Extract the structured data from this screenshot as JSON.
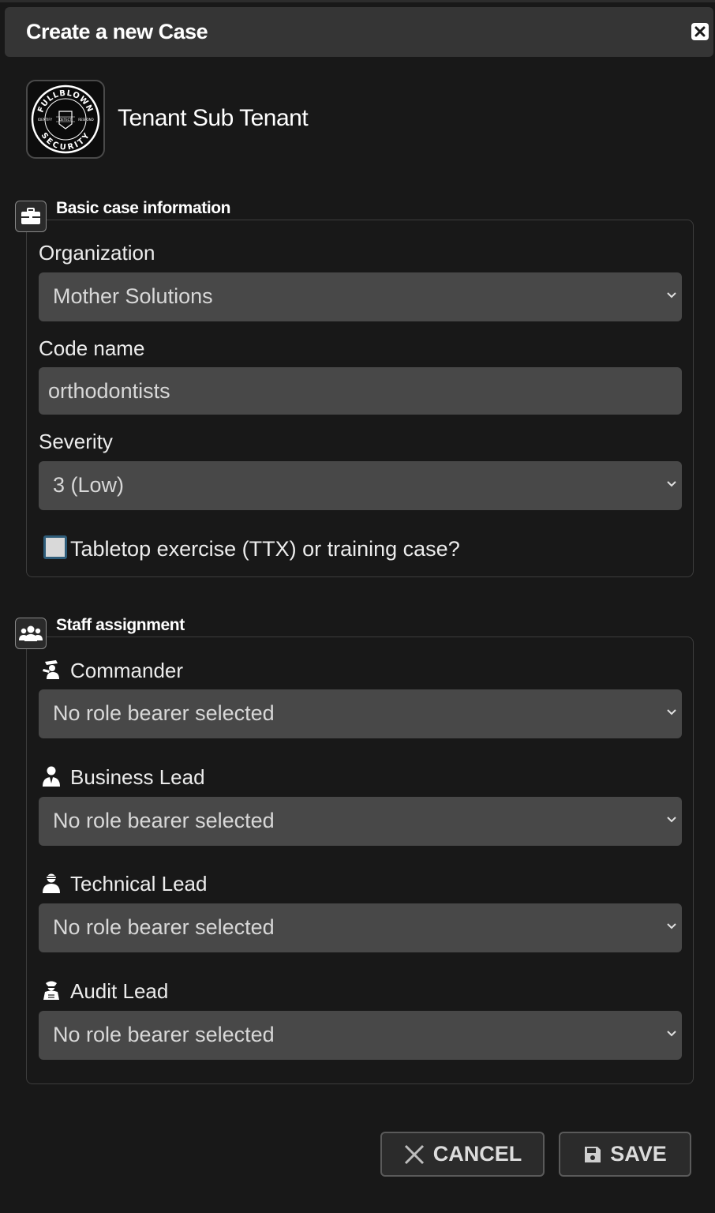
{
  "dialog": {
    "title": "Create a new Case",
    "close_icon": "close-icon"
  },
  "tenant": {
    "name": "Tenant Sub Tenant",
    "logo": {
      "top_text": "FULLBLOWN",
      "bottom_text": "SECURITY",
      "left_text": "IDENTIFY",
      "middle_text": "DETECT",
      "right_text": "RESPOND"
    }
  },
  "basic_info": {
    "legend": "Basic case information",
    "icon": "briefcase-icon",
    "organization": {
      "label": "Organization",
      "value": "Mother Solutions"
    },
    "code_name": {
      "label": "Code name",
      "value": "orthodontists"
    },
    "severity": {
      "label": "Severity",
      "value": "3 (Low)"
    },
    "ttx": {
      "label": "Tabletop exercise (TTX) or training case?",
      "checked": false
    }
  },
  "staff": {
    "legend": "Staff assignment",
    "icon": "users-icon",
    "roles": [
      {
        "label": "Commander",
        "value": "No role bearer selected",
        "icon": "commander-icon"
      },
      {
        "label": "Business Lead",
        "value": "No role bearer selected",
        "icon": "business-person-icon"
      },
      {
        "label": "Technical Lead",
        "value": "No role bearer selected",
        "icon": "technician-icon"
      },
      {
        "label": "Audit Lead",
        "value": "No role bearer selected",
        "icon": "auditor-icon"
      }
    ]
  },
  "actions": {
    "cancel_label": "CANCEL",
    "save_label": "SAVE"
  }
}
